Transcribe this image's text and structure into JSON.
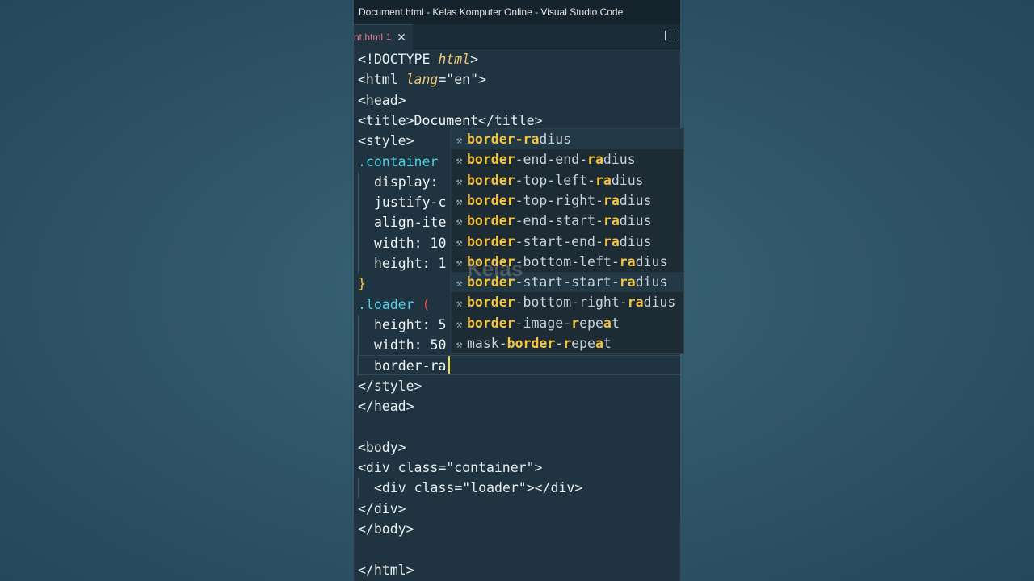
{
  "window": {
    "title": "Document.html - Kelas Komputer Online - Visual Studio Code"
  },
  "tab": {
    "label": "nt.html",
    "badge": "1",
    "close": "✕"
  },
  "code_lines": [
    {
      "parts": [
        [
          "c-tag",
          "<!DOCTYPE "
        ],
        [
          "c-kw",
          "html"
        ],
        [
          "c-tag",
          ">"
        ]
      ]
    },
    {
      "parts": [
        [
          "c-tag",
          "<html "
        ],
        [
          "c-kw",
          "lang"
        ],
        [
          "c-tag",
          "=\"en\">"
        ]
      ]
    },
    {
      "parts": [
        [
          "c-tag",
          "<head>"
        ]
      ]
    },
    {
      "parts": [
        [
          "c-tag",
          "<title>"
        ],
        [
          "c-prop",
          "Document"
        ],
        [
          "c-tag",
          "</title>"
        ]
      ]
    },
    {
      "parts": [
        [
          "c-tag",
          "<style>"
        ]
      ]
    },
    {
      "parts": [
        [
          "c-sel",
          ".container"
        ]
      ]
    },
    {
      "indent": true,
      "parts": [
        [
          "c-prop",
          "display:"
        ]
      ]
    },
    {
      "indent": true,
      "parts": [
        [
          "c-prop",
          "justify-c"
        ]
      ]
    },
    {
      "indent": true,
      "parts": [
        [
          "c-prop",
          "align-ite"
        ]
      ]
    },
    {
      "indent": true,
      "parts": [
        [
          "c-prop",
          "width: 10"
        ]
      ]
    },
    {
      "indent": true,
      "parts": [
        [
          "c-prop",
          "height: 1"
        ]
      ]
    },
    {
      "parts": [
        [
          "c-brace",
          "}"
        ]
      ]
    },
    {
      "parts": [
        [
          "c-sel",
          ".loader "
        ],
        [
          "c-paren",
          "("
        ]
      ]
    },
    {
      "indent": true,
      "parts": [
        [
          "c-prop",
          "height: 5"
        ]
      ]
    },
    {
      "indent": true,
      "parts": [
        [
          "c-prop",
          "width: 50"
        ]
      ]
    },
    {
      "indent": true,
      "parts": [
        [
          "c-prop",
          "border-ra"
        ]
      ]
    },
    {
      "parts": [
        [
          "c-tag",
          "</style>"
        ]
      ]
    },
    {
      "parts": [
        [
          "c-tag",
          "</head>"
        ]
      ]
    },
    {
      "parts": [
        [
          "c-tag",
          ""
        ]
      ]
    },
    {
      "parts": [
        [
          "c-tag",
          "<body>"
        ]
      ]
    },
    {
      "parts": [
        [
          "c-tag",
          "<div class=\"container\">"
        ]
      ]
    },
    {
      "indent": true,
      "parts": [
        [
          "c-tag",
          "<div class=\"loader\"></div>"
        ]
      ]
    },
    {
      "parts": [
        [
          "c-tag",
          "</div>"
        ]
      ]
    },
    {
      "parts": [
        [
          "c-tag",
          "</body>"
        ]
      ]
    },
    {
      "parts": [
        [
          "c-tag",
          ""
        ]
      ]
    },
    {
      "parts": [
        [
          "c-tag",
          "</html>"
        ]
      ]
    }
  ],
  "suggestions": [
    {
      "selected": true,
      "parts": [
        [
          "hl",
          "border-ra"
        ],
        [
          "",
          "dius"
        ]
      ]
    },
    {
      "parts": [
        [
          "hl",
          "border"
        ],
        [
          "",
          "-end-end-"
        ],
        [
          "hl",
          "ra"
        ],
        [
          "",
          "dius"
        ]
      ]
    },
    {
      "parts": [
        [
          "hl",
          "border"
        ],
        [
          "",
          "-top-left-"
        ],
        [
          "hl",
          "ra"
        ],
        [
          "",
          "dius"
        ]
      ]
    },
    {
      "parts": [
        [
          "hl",
          "border"
        ],
        [
          "",
          "-top-right-"
        ],
        [
          "hl",
          "ra"
        ],
        [
          "",
          "dius"
        ]
      ]
    },
    {
      "parts": [
        [
          "hl",
          "border"
        ],
        [
          "",
          "-end-start-"
        ],
        [
          "hl",
          "ra"
        ],
        [
          "",
          "dius"
        ]
      ]
    },
    {
      "parts": [
        [
          "hl",
          "border"
        ],
        [
          "",
          "-start-end-"
        ],
        [
          "hl",
          "ra"
        ],
        [
          "",
          "dius"
        ]
      ]
    },
    {
      "parts": [
        [
          "hl",
          "border"
        ],
        [
          "",
          "-bottom-left-"
        ],
        [
          "hl",
          "ra"
        ],
        [
          "",
          "dius"
        ]
      ]
    },
    {
      "selected": true,
      "parts": [
        [
          "hl",
          "border"
        ],
        [
          "",
          "-start-start-"
        ],
        [
          "hl",
          "ra"
        ],
        [
          "",
          "dius"
        ]
      ]
    },
    {
      "parts": [
        [
          "hl",
          "border"
        ],
        [
          "",
          "-bottom-right-"
        ],
        [
          "hl",
          "ra"
        ],
        [
          "",
          "dius"
        ]
      ]
    },
    {
      "parts": [
        [
          "hl",
          "border"
        ],
        [
          "",
          "-image-"
        ],
        [
          "hl",
          "r"
        ],
        [
          "",
          "epe"
        ],
        [
          "hl",
          "a"
        ],
        [
          "",
          "t"
        ]
      ]
    },
    {
      "parts": [
        [
          "",
          "mask-"
        ],
        [
          "hl",
          "border"
        ],
        [
          "",
          "-"
        ],
        [
          "hl",
          "r"
        ],
        [
          "",
          "epe"
        ],
        [
          "hl",
          "a"
        ],
        [
          "",
          "t"
        ]
      ]
    }
  ],
  "watermark": {
    "text": "Kelas"
  },
  "colors": {
    "accent": "#f5c542",
    "selector": "#4fd1e3",
    "tab_label": "#e07a8a"
  }
}
